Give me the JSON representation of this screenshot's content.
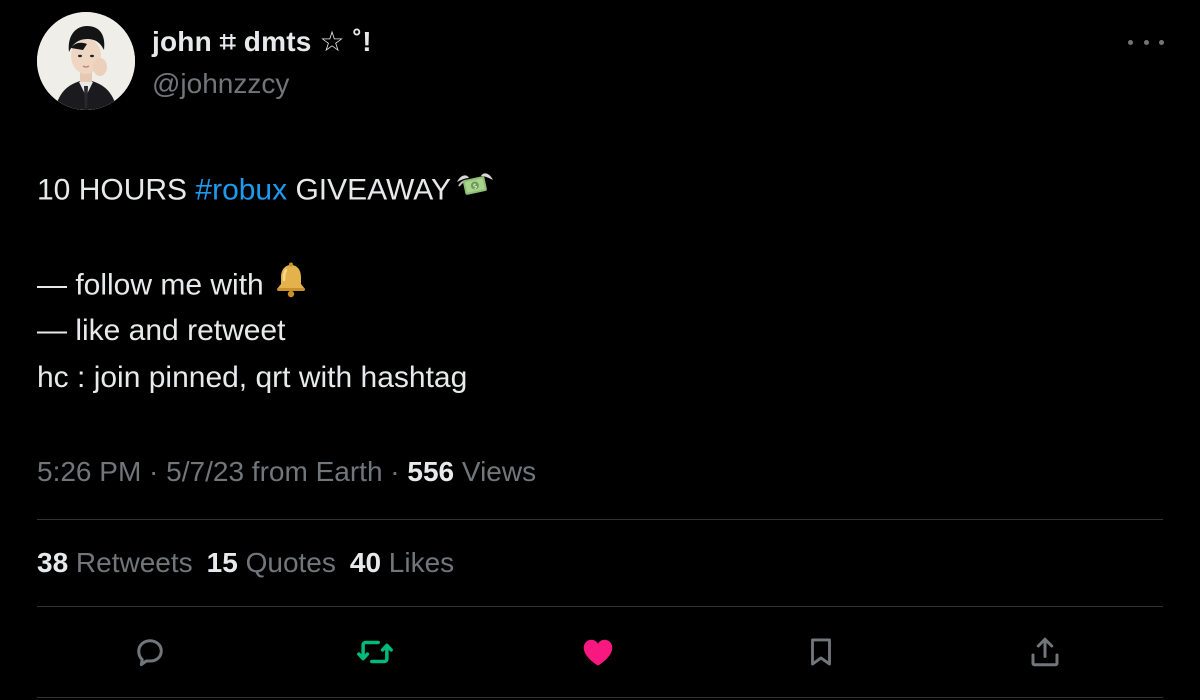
{
  "author": {
    "display_name": "john ⌗ dmts ☆ ˚!",
    "handle": "@johnzzcy"
  },
  "tweet": {
    "line1_prefix": "10 HOURS ",
    "hashtag": "#robux",
    "line1_suffix": " GIVEAWAY",
    "line2": "— follow me with",
    "line3": "— like and retweet",
    "line4": "hc : join pinned, qrt with hashtag",
    "emoji_1": "money-with-wings-icon",
    "emoji_2": "bell-icon"
  },
  "meta": {
    "time": "5:26 PM",
    "sep1": " · ",
    "date": "5/7/23",
    "source": " from Earth",
    "sep2": " · ",
    "views_count": "556",
    "views_label": " Views"
  },
  "stats": {
    "retweets_count": "38",
    "retweets_label": " Retweets",
    "quotes_count": "15",
    "quotes_label": " Quotes",
    "likes_count": "40",
    "likes_label": " Likes"
  },
  "actions": {
    "reply": "reply-icon",
    "retweet": "retweet-icon",
    "like": "heart-icon",
    "bookmark": "bookmark-icon",
    "share": "share-icon"
  },
  "colors": {
    "background": "#000000",
    "text": "#e7e9ea",
    "muted": "#71767b",
    "link": "#1d9bf0",
    "retweet_active": "#00ba7c",
    "like_active": "#f91880",
    "divider": "#2f3336"
  }
}
